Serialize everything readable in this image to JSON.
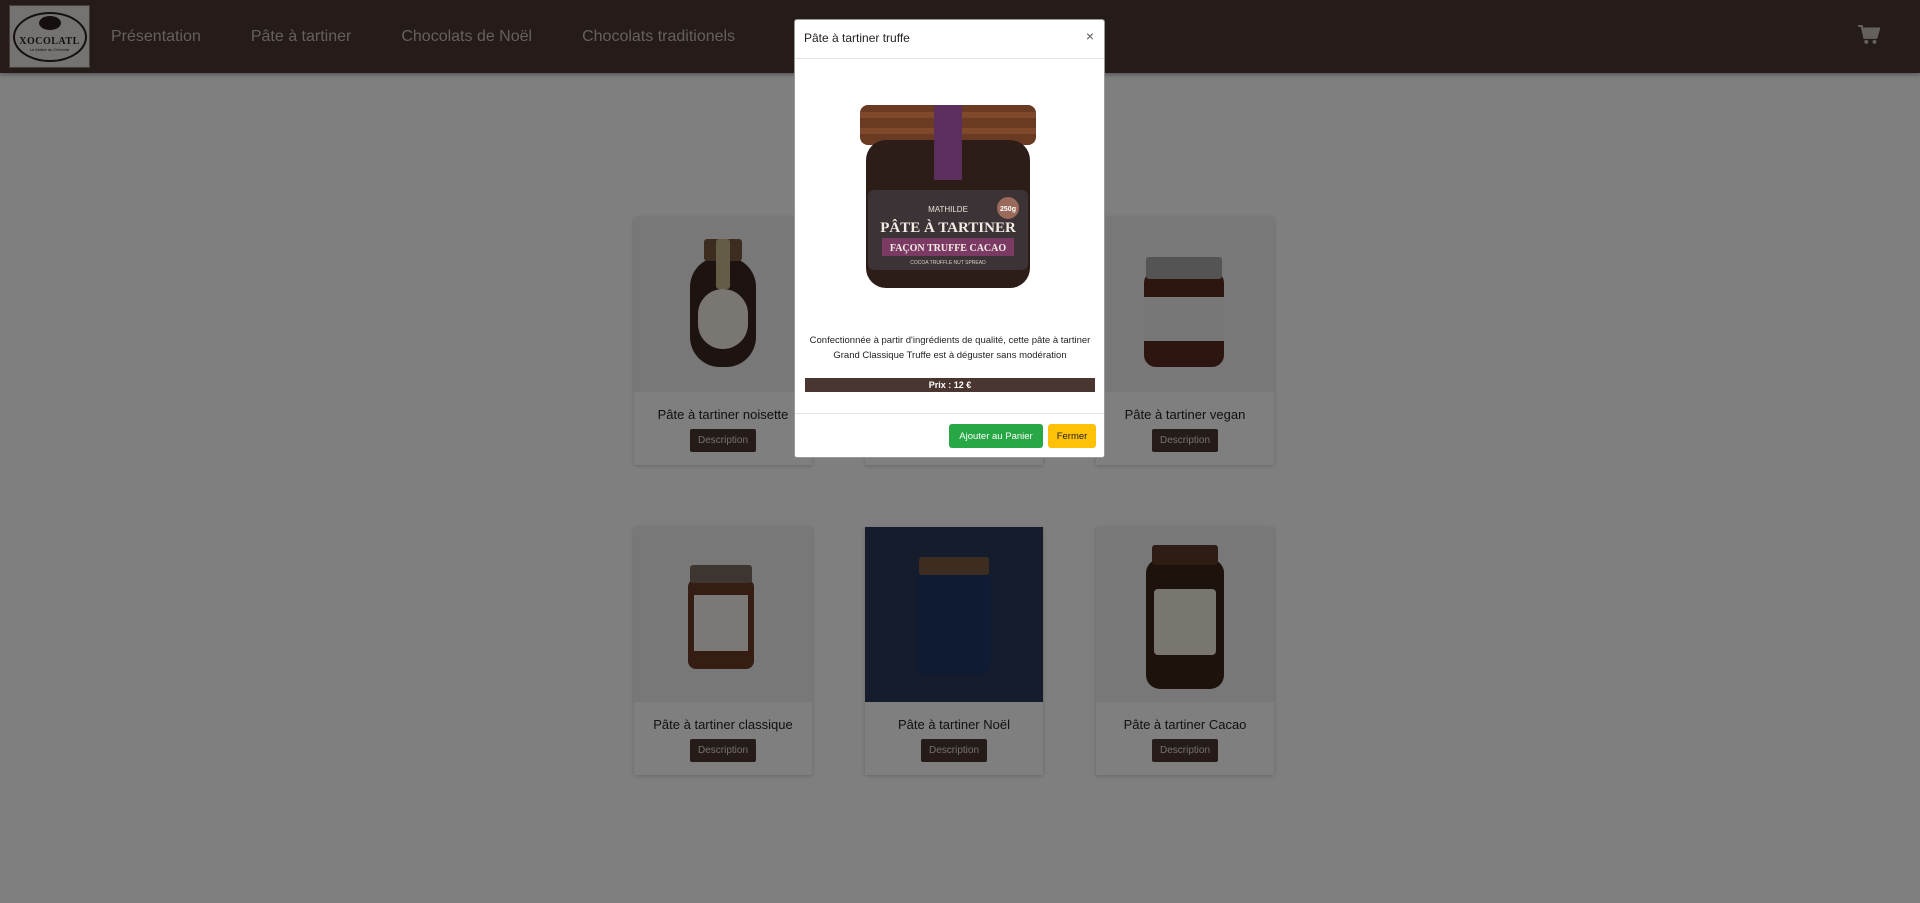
{
  "brand": {
    "name": "XOCOLATL",
    "tagline": "Le Maître du Chocolat"
  },
  "nav": {
    "items": [
      {
        "label": "Présentation"
      },
      {
        "label": "Pâte à tartiner"
      },
      {
        "label": "Chocolats de Noël"
      },
      {
        "label": "Chocolats traditionels"
      }
    ]
  },
  "products": [
    {
      "name": "Pâte à tartiner noisette",
      "button": "Description"
    },
    {
      "name": "Pâte à tartiner vegan",
      "button": "Description"
    },
    {
      "name": "Pâte à tartiner classique",
      "button": "Description"
    },
    {
      "name": "Pâte à tartiner Noël",
      "button": "Description"
    },
    {
      "name": "Pâte à tartiner Cacao",
      "button": "Description"
    }
  ],
  "modal": {
    "title": "Pâte à tartiner truffe",
    "close_glyph": "×",
    "jar_label": {
      "brand": "MATHILDE",
      "title": "PÂTE À TARTINER",
      "subtitle": "FAÇON TRUFFE CACAO",
      "english": "COCOA TRUFFLE NUT SPREAD",
      "weight": "250g"
    },
    "description": "Confectionnée à partir d'ingrédients de qualité, cette pâte à tartiner Grand Classique Truffe est à déguster sans modération",
    "price": "Prix : 12 €",
    "add_button": "Ajouter au Panier",
    "close_button": "Fermer"
  },
  "colors": {
    "navbar": "#4a3630",
    "accent_brown": "#4a3630",
    "success": "#28a745",
    "warning": "#ffc107"
  },
  "icons": {
    "cart": "cart-icon",
    "close": "close-icon"
  }
}
